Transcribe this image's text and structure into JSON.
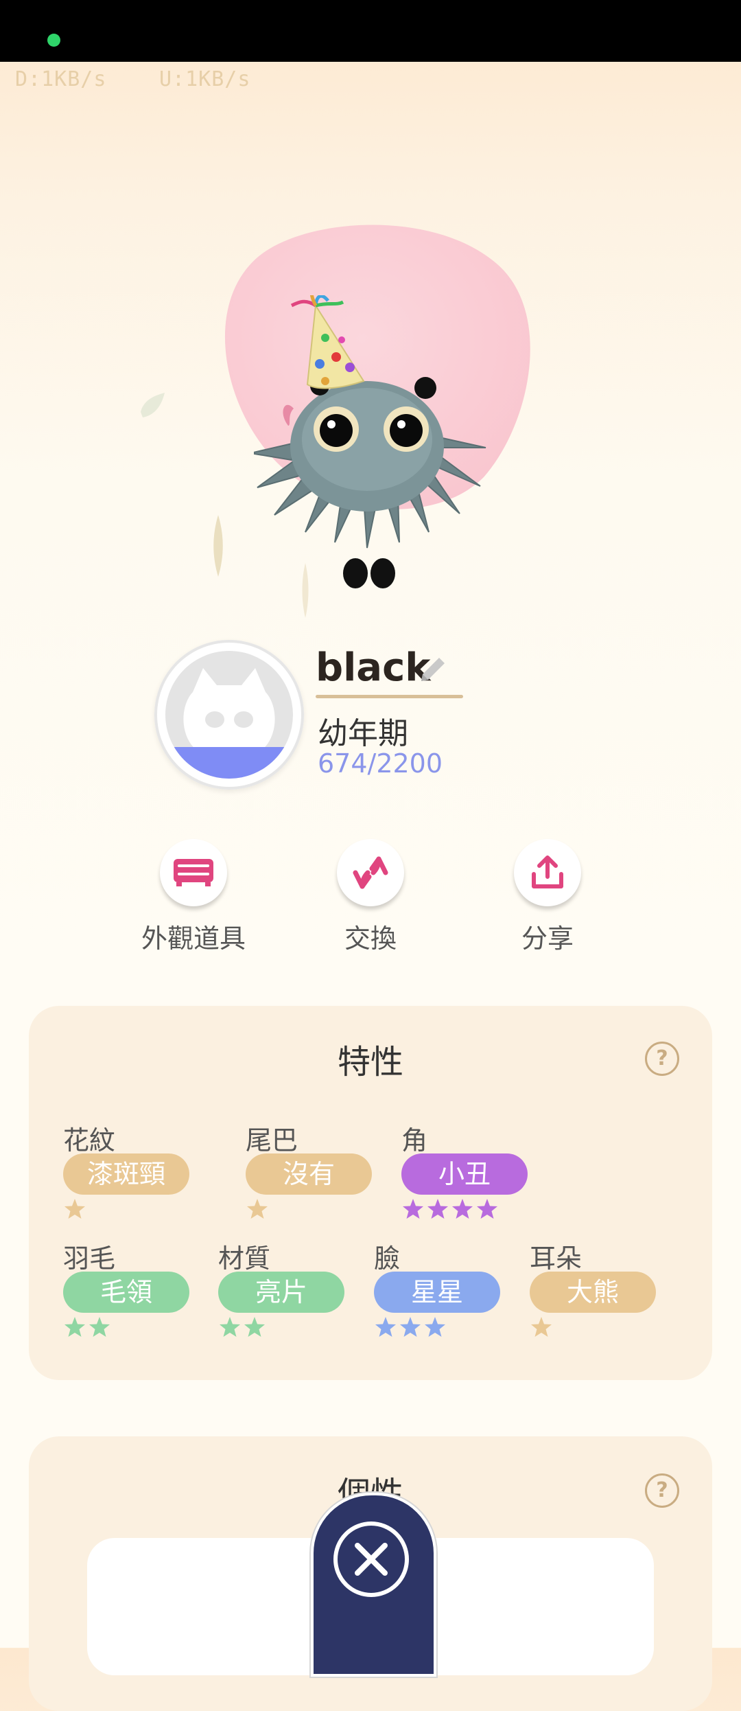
{
  "status": {
    "download": "D:1KB/s",
    "upload": "U:1KB/s",
    "dot_color": "#2fd46a"
  },
  "pet": {
    "name": "black",
    "stage": "幼年期",
    "exp_text": "674/2200",
    "exp_fraction": 0.306
  },
  "actions": [
    {
      "label": "外觀道具",
      "icon": "dresser-icon"
    },
    {
      "label": "交換",
      "icon": "swap-icon"
    },
    {
      "label": "分享",
      "icon": "share-icon"
    }
  ],
  "traits_card": {
    "title": "特性",
    "traits": [
      {
        "label": "花紋",
        "value": "漆斑頸",
        "color": "#e9c894",
        "stars": 1,
        "star_color": "#e9c894"
      },
      {
        "label": "尾巴",
        "value": "沒有",
        "color": "#e9c894",
        "stars": 1,
        "star_color": "#e9c894"
      },
      {
        "label": "角",
        "value": "小丑",
        "color": "#b86bde",
        "stars": 4,
        "star_color": "#b86bde"
      },
      {
        "label": "羽毛",
        "value": "毛領",
        "color": "#8fd6a2",
        "stars": 2,
        "star_color": "#8fd6a2"
      },
      {
        "label": "材質",
        "value": "亮片",
        "color": "#8fd6a2",
        "stars": 2,
        "star_color": "#8fd6a2"
      },
      {
        "label": "臉",
        "value": "星星",
        "color": "#8aa9ee",
        "stars": 3,
        "star_color": "#8aa9ee"
      },
      {
        "label": "耳朵",
        "value": "大熊",
        "color": "#e9c894",
        "stars": 1,
        "star_color": "#e9c894"
      }
    ]
  },
  "personality_card": {
    "title": "個性"
  },
  "colors": {
    "accent_pink": "#e0457f",
    "exp_blue": "#8a95ea",
    "close_navy": "#2d3566"
  }
}
